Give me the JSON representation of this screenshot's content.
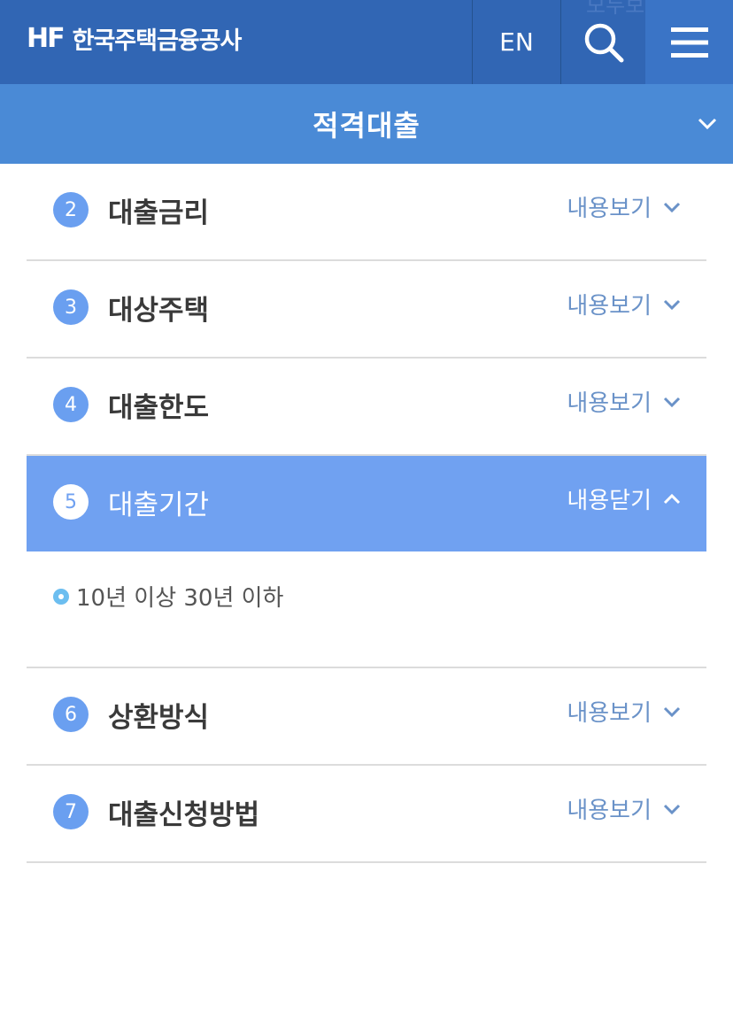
{
  "header": {
    "logo_mark": "HF",
    "logo_text": "한국주택금융공사",
    "lang_label": "EN",
    "ghost_text": "모두보",
    "search_icon": "search-icon",
    "menu_icon": "hamburger-menu-icon",
    "bg_color": "#3166b4"
  },
  "section": {
    "title": "적격대출",
    "bg_color": "#4a8ad6"
  },
  "accordion": {
    "items": [
      {
        "num": "2",
        "title": "대출금리",
        "toggle": "내용보기",
        "open": false
      },
      {
        "num": "3",
        "title": "대상주택",
        "toggle": "내용보기",
        "open": false
      },
      {
        "num": "4",
        "title": "대출한도",
        "toggle": "내용보기",
        "open": false
      },
      {
        "num": "5",
        "title": "대출기간",
        "toggle": "내용닫기",
        "open": true,
        "content": "10년 이상 30년 이하"
      },
      {
        "num": "6",
        "title": "상환방식",
        "toggle": "내용보기",
        "open": false
      },
      {
        "num": "7",
        "title": "대출신청방법",
        "toggle": "내용보기",
        "open": false
      }
    ],
    "active_color": "#70a1f1",
    "badge_color": "#6a9ff0"
  }
}
